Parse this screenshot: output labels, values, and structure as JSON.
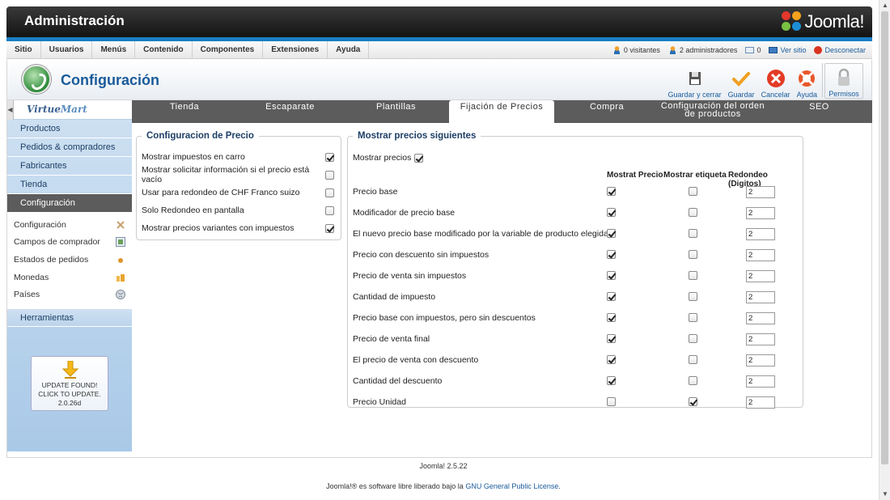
{
  "header": {
    "title": "Administración",
    "logo_text": "Joomla!"
  },
  "menubar": {
    "items": [
      "Sitio",
      "Usuarios",
      "Menús",
      "Contenido",
      "Componentes",
      "Extensiones",
      "Ayuda"
    ],
    "visitors": "0 visitantes",
    "admins": "2 administradores",
    "messages": "0",
    "view_site": "Ver sitio",
    "logout": "Desconectar"
  },
  "toolbar": {
    "title": "Configuración",
    "buttons": [
      "Guardar y cerrar",
      "Guardar",
      "Cancelar",
      "Ayuda"
    ],
    "permissions": "Permisos"
  },
  "sidebar": {
    "logo_prefix": "Virtue",
    "logo_suffix": "Mart",
    "items": [
      "Productos",
      "Pedidos & compradores",
      "Fabricantes",
      "Tienda",
      "Configuración"
    ],
    "sub_items": [
      "Configuración",
      "Campos de comprador",
      "Estados de pedidos",
      "Monedas",
      "Países"
    ],
    "tools": "Herramientas",
    "update_line1": "UPDATE FOUND!",
    "update_line2": "CLICK TO UPDATE.",
    "update_version": "2.0.26d"
  },
  "tabs": [
    "Tienda",
    "Escaparate",
    "Plantillas",
    "Fijación de Precios",
    "Compra",
    "Configuración del orden de productos",
    "SEO"
  ],
  "price_config": {
    "legend": "Configuracion de Precio",
    "options": [
      {
        "label": "Mostrar impuestos en carro",
        "checked": true
      },
      {
        "label": "Mostrar solicitar información si el precio está vacío",
        "checked": false
      },
      {
        "label": "Usar para redondeo de CHF Franco suizo",
        "checked": false
      },
      {
        "label": "Solo Redondeo en pantalla",
        "checked": false
      },
      {
        "label": "Mostrar precios variantes con impuestos",
        "checked": true
      }
    ]
  },
  "show_prices": {
    "legend": "Mostrar precios siguientes",
    "show_prices_label": "Mostrar precios",
    "show_prices_checked": true,
    "col_show_price": "Mostrat Precio",
    "col_show_label": "Mostrar etiqueta",
    "col_rounding": "Redondeo (Digitos)",
    "rows": [
      {
        "label": "Precio base",
        "price": true,
        "tag": false,
        "round": "2"
      },
      {
        "label": "Modificador de precio base",
        "price": true,
        "tag": false,
        "round": "2"
      },
      {
        "label": "El nuevo precio base modificado por la variable de producto elegida",
        "price": true,
        "tag": false,
        "round": "2"
      },
      {
        "label": "Precio con descuento sin impuestos",
        "price": true,
        "tag": false,
        "round": "2"
      },
      {
        "label": "Precio de venta sin impuestos",
        "price": true,
        "tag": false,
        "round": "2"
      },
      {
        "label": "Cantidad de impuesto",
        "price": true,
        "tag": false,
        "round": "2"
      },
      {
        "label": "Precio base con impuestos, pero sin descuentos",
        "price": true,
        "tag": false,
        "round": "2"
      },
      {
        "label": "Precio de venta final",
        "price": true,
        "tag": false,
        "round": "2"
      },
      {
        "label": "El precio de venta con descuento",
        "price": true,
        "tag": false,
        "round": "2"
      },
      {
        "label": "Cantidad del descuento",
        "price": true,
        "tag": false,
        "round": "2"
      },
      {
        "label": "Precio Unidad",
        "price": false,
        "tag": true,
        "round": "2"
      }
    ]
  },
  "footer": {
    "version": "Joomla! 2.5.22",
    "license_pre": "Joomla!® es software libre liberado bajo la",
    "license_link": "GNU General Public License",
    "license_post": "."
  }
}
